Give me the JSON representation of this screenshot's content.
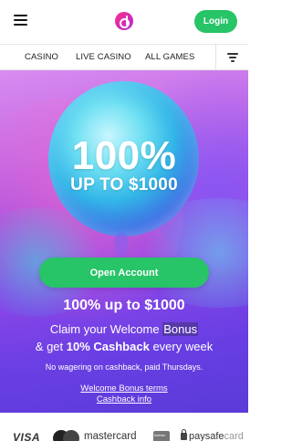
{
  "header": {
    "login_label": "Login",
    "logo_letter": "d"
  },
  "tabs": [
    {
      "label": "CASINO"
    },
    {
      "label": "LIVE CASINO"
    },
    {
      "label": "ALL GAMES"
    }
  ],
  "hero": {
    "orb_big": "100%",
    "orb_small": "UP TO $1000",
    "open_account_label": "Open Account",
    "promo_title": "100% up to $1000",
    "promo_line1_prefix": "Claim your Welcome ",
    "promo_line1_highlight": "Bonus",
    "promo_line2_prefix": "& get ",
    "promo_line2_bold": "10% Cashback",
    "promo_line2_suffix": " every week",
    "promo_note": "No wagering on cashback, paid Thursdays.",
    "link_terms": "Welcome Bonus terms",
    "link_cashback": "Cashback info"
  },
  "payments": {
    "visa": "VISA",
    "mastercard": "mastercard",
    "interac": "Interac",
    "paysafe_main": "paysafe",
    "paysafe_suffix": "card"
  },
  "colors": {
    "accent_green": "#27c468",
    "logo_pink": "#ff2d8a"
  }
}
